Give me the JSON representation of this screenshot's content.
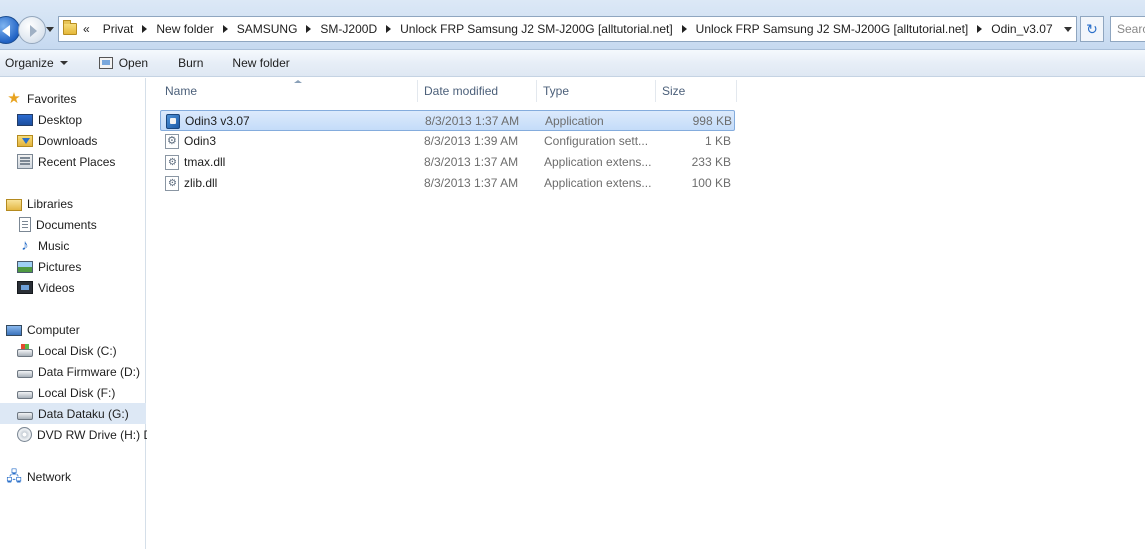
{
  "address_bar": {
    "overflow": "«",
    "breadcrumbs": [
      "Privat",
      "New folder",
      "SAMSUNG",
      "SM-J200D",
      "Unlock FRP Samsung J2 SM-J200G [alltutorial.net]",
      "Unlock FRP Samsung J2 SM-J200G [alltutorial.net]",
      "Odin_v3.07"
    ],
    "search_placeholder": "Search"
  },
  "toolbar": {
    "organize": "Organize",
    "open": "Open",
    "burn": "Burn",
    "new_folder": "New folder"
  },
  "nav": {
    "favorites": {
      "label": "Favorites",
      "items": [
        {
          "label": "Desktop",
          "icon": "desktop-icon"
        },
        {
          "label": "Downloads",
          "icon": "downloads-icon"
        },
        {
          "label": "Recent Places",
          "icon": "recent-places-icon"
        }
      ]
    },
    "libraries": {
      "label": "Libraries",
      "items": [
        {
          "label": "Documents",
          "icon": "documents-icon"
        },
        {
          "label": "Music",
          "icon": "music-icon"
        },
        {
          "label": "Pictures",
          "icon": "pictures-icon"
        },
        {
          "label": "Videos",
          "icon": "videos-icon"
        }
      ]
    },
    "computer": {
      "label": "Computer",
      "items": [
        {
          "label": "Local Disk (C:)",
          "icon": "system-disk-icon"
        },
        {
          "label": "Data Firmware (D:)",
          "icon": "disk-icon"
        },
        {
          "label": "Local Disk (F:)",
          "icon": "disk-icon"
        },
        {
          "label": "Data Dataku (G:)",
          "icon": "disk-icon",
          "selected": true
        },
        {
          "label": "DVD RW Drive (H:) D",
          "icon": "dvd-icon"
        }
      ]
    },
    "network": {
      "label": "Network"
    }
  },
  "columns": {
    "name": "Name",
    "date": "Date modified",
    "type": "Type",
    "size": "Size"
  },
  "files": [
    {
      "name": "Odin3 v3.07",
      "date": "8/3/2013 1:37 AM",
      "type": "Application",
      "size": "998 KB",
      "icon": "application-icon",
      "selected": true
    },
    {
      "name": "Odin3",
      "date": "8/3/2013 1:39 AM",
      "type": "Configuration sett...",
      "size": "1 KB",
      "icon": "config-file-icon"
    },
    {
      "name": "tmax.dll",
      "date": "8/3/2013 1:37 AM",
      "type": "Application extens...",
      "size": "233 KB",
      "icon": "dll-file-icon"
    },
    {
      "name": "zlib.dll",
      "date": "8/3/2013 1:37 AM",
      "type": "Application extens...",
      "size": "100 KB",
      "icon": "dll-file-icon"
    }
  ],
  "colors": {
    "selection_fill": "#c4dcf9",
    "selection_border": "#84acdd",
    "nav_selected": "#dde8f5"
  }
}
